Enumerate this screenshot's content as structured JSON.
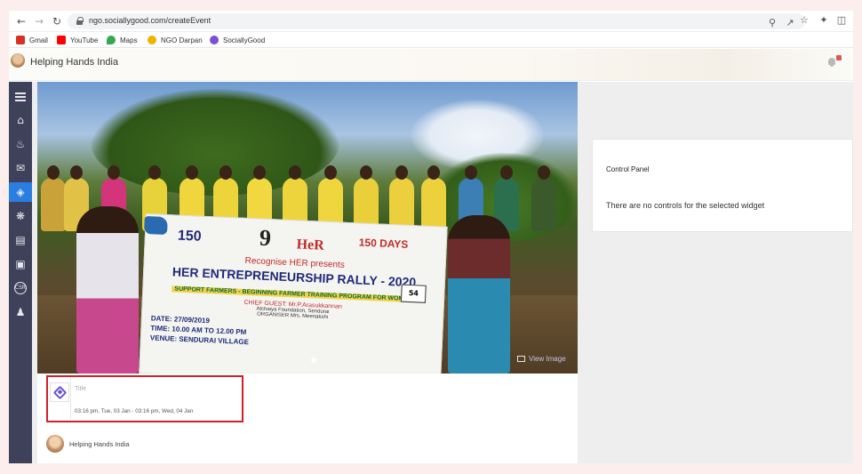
{
  "browser": {
    "url": "ngo.sociallygood.com/createEvent",
    "bookmarks": [
      {
        "label": "Gmail",
        "icon": "gmail-icon",
        "color": "#d93025"
      },
      {
        "label": "YouTube",
        "icon": "youtube-icon",
        "color": "#ff0000"
      },
      {
        "label": "Maps",
        "icon": "maps-icon",
        "color": "#34a853"
      },
      {
        "label": "NGO Darpan",
        "icon": "ngo-darpan-icon",
        "color": "#f0b400"
      },
      {
        "label": "SociallyGood",
        "icon": "sociallygood-icon",
        "color": "#7b4fd8"
      }
    ]
  },
  "header": {
    "org_name": "Helping Hands India"
  },
  "sidebar": {
    "items": [
      {
        "icon": "menu-icon"
      },
      {
        "icon": "home-icon"
      },
      {
        "icon": "donate-hands-icon"
      },
      {
        "icon": "campaign-icon"
      },
      {
        "icon": "events-icon",
        "active": true
      },
      {
        "icon": "volunteer-icon"
      },
      {
        "icon": "contacts-icon"
      },
      {
        "icon": "transport-icon"
      },
      {
        "icon": "csr-icon",
        "label": "CSR"
      },
      {
        "icon": "team-icon"
      }
    ]
  },
  "hero": {
    "view_image_label": "View Image",
    "banner": {
      "line1": "Recognise HER presents",
      "line2": "HER ENTREPRENEURSHIP RALLY - 2020",
      "line3": "SUPPORT FARMERS - BEGINNING FARMER TRAINING PROGRAM FOR WOMEN",
      "line4": "CHIEF GUEST: Mr.P.Arasukkannan",
      "line5": "Atchaiya Foundation, Sendurai",
      "line6": "ORGANISER  Mrs. Meenakshi",
      "date": "DATE: 27/09/2019",
      "time": "TIME: 10.00 AM TO 12.00 PM",
      "venue": "VENUE: SENDURAI VILLAGE",
      "badge": "54",
      "num150": "150",
      "her": "HeR",
      "nine": "9",
      "days150": "150 DAYS"
    }
  },
  "event": {
    "title_placeholder": "Title",
    "time_range": "03:16 pm, Tue, 03 Jan - 03:16 pm, Wed, 04 Jan"
  },
  "host": {
    "name": "Helping Hands India"
  },
  "control_panel": {
    "title": "Control Panel",
    "message": "There are no controls for the selected widget"
  }
}
